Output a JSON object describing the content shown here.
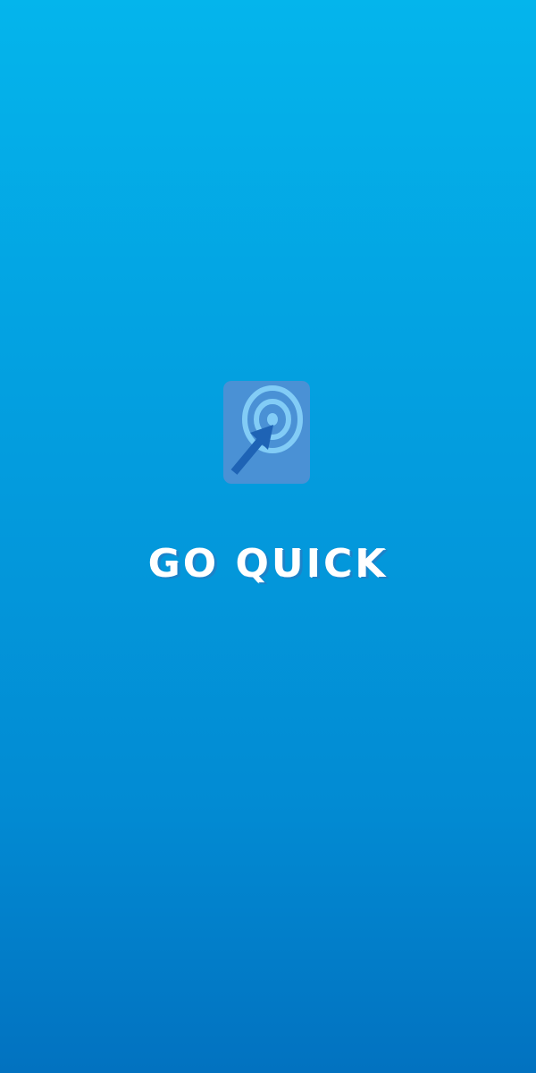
{
  "app": {
    "name": "GO QUICK",
    "logo_icon": "target-arrow-icon"
  },
  "colors": {
    "background_top": "#04b5ec",
    "background_bottom": "#0272c0",
    "logo_tile": "#4a91d5",
    "logo_rings": "#82ccf6",
    "logo_arrow": "#1e63b5",
    "title_text": "#ffffff",
    "title_shadow": "#1c83c9"
  }
}
